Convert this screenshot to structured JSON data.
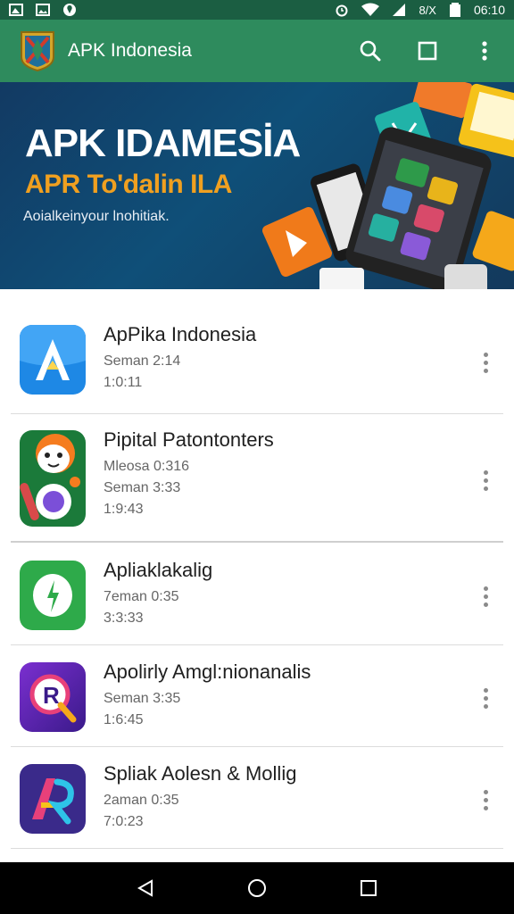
{
  "status_bar": {
    "signal_text": "8/X",
    "time": "06:10",
    "left_icons": [
      "photo-icon",
      "image-icon",
      "location-pin-icon"
    ],
    "right_icons": [
      "alarm-icon",
      "wifi-icon",
      "cell-signal-icon",
      "battery-icon"
    ]
  },
  "app_bar": {
    "title": "APK Indonesia",
    "actions": [
      "search-icon",
      "square-icon",
      "more-vert-icon"
    ]
  },
  "banner": {
    "title": "APK IDAMESİA",
    "subtitle": "APR To'dalin ILA",
    "tagline": "Aoialkeinyour lnohitiak."
  },
  "apps": [
    {
      "name": "ApPika Indonesia",
      "line1": "Seman 2:14",
      "line2": "1:0:11"
    },
    {
      "name": "Pipital Patontonters",
      "line1": "Mleosa 0:316",
      "line2": "Seman 3:33",
      "line3": "1:9:43"
    },
    {
      "name": "Apliaklakalig",
      "line1": "7eman 0:35",
      "line2": "3:3:33"
    },
    {
      "name": "Apolirly Amgl:nionanalis",
      "line1": "Seman 3:35",
      "line2": "1:6:45"
    },
    {
      "name": "Spliak Aolesn & Mollig",
      "line1": "2aman 0:35",
      "line2": "7:0:23"
    }
  ],
  "colors": {
    "status_bar": "#1b5e42",
    "app_bar": "#2e8b5d",
    "banner_accent": "#f0a020",
    "nav_bar": "#000000"
  },
  "nav_bar": {
    "buttons": [
      "back-icon",
      "home-icon",
      "recents-icon"
    ]
  }
}
